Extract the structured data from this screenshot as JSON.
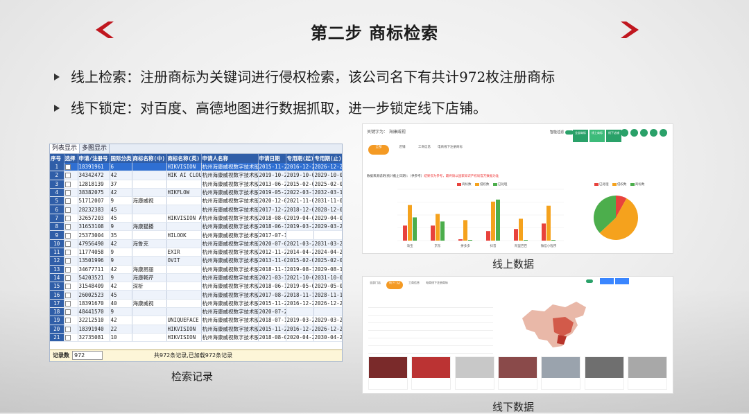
{
  "slide": {
    "title": "第二步 商标检索",
    "bullets": [
      "线上检索：注册商标为关键词进行侵权检索，该公司名下有共计972枚注册商标",
      "线下锁定：对百度、高德地图进行数据抓取，进一步锁定线下店铺。"
    ],
    "captions": {
      "records": "检索记录",
      "online": "线上数据",
      "offline": "线下数据"
    },
    "accent_color": "#c0171f"
  },
  "records": {
    "tabs": [
      "列表显示",
      "多图显示"
    ],
    "columns": [
      "序号",
      "选择",
      "申请/注册号",
      "国际分类",
      "商标名称(中)",
      "商标名称(英)",
      "申请人名称",
      "申请日期",
      "专用期(起)",
      "专用期(止)"
    ],
    "rows": [
      [
        "1",
        "",
        "18391961",
        "6",
        "",
        "HIKVISION",
        "杭州海康威视数字技术股份有",
        "2015-11-23",
        "2016-12-28",
        "2026-12-27"
      ],
      [
        "2",
        "",
        "34342472",
        "42",
        "",
        "HIK AI CLOUD",
        "杭州海康威视数字技术股份有",
        "2019-10-29",
        "2019-10-07",
        "2029-10-06"
      ],
      [
        "3",
        "",
        "12818139",
        "37",
        "",
        "",
        "杭州海康威视数字技术股份有",
        "2013-06-26",
        "2015-02-07",
        "2025-02-06"
      ],
      [
        "4",
        "",
        "38382075",
        "42",
        "",
        "HIKFLOW",
        "杭州海康威视数字技术股份有",
        "2019-05-23",
        "2022-03-14",
        "2032-03-13"
      ],
      [
        "5",
        "",
        "51712007",
        "9",
        "海康威视",
        "",
        "杭州海康威视数字技术股份有",
        "2020-12-01",
        "2021-11-07",
        "2031-11-06"
      ],
      [
        "6",
        "",
        "28232383",
        "45",
        "",
        "",
        "杭州海康威视数字技术股份有",
        "2017-12-21",
        "2018-12-07",
        "2028-12-06"
      ],
      [
        "7",
        "",
        "32657203",
        "45",
        "",
        "HIKVISION AI CL",
        "杭州海康威视数字技术股份有",
        "2018-08-02",
        "2019-04-07",
        "2029-04-06"
      ],
      [
        "8",
        "",
        "31653108",
        "9",
        "海康猫播",
        "",
        "杭州海康威视数字技术股份有",
        "2018-06-15",
        "2019-03-21",
        "2029-03-20"
      ],
      [
        "9",
        "",
        "25373004",
        "35",
        "",
        "HILOOK",
        "杭州海康威视数字技术股份有",
        "2017-07-18",
        "",
        ""
      ],
      [
        "10",
        "",
        "47956490",
        "42",
        "海鲁克",
        "",
        "杭州海康威视数字技术股份有",
        "2020-07-09",
        "2021-03-21",
        "2031-03-20"
      ],
      [
        "11",
        "",
        "11774058",
        "9",
        "",
        "EXIR",
        "杭州海康威视数字技术股份有",
        "2012-11-20",
        "2014-04-28",
        "2024-04-27"
      ],
      [
        "12",
        "",
        "13501996",
        "9",
        "",
        "OVIT",
        "杭州海康威视数字技术股份有",
        "2013-11-07",
        "2015-02-07",
        "2025-02-06"
      ],
      [
        "13",
        "",
        "34677711",
        "42",
        "海康昂丽",
        "",
        "杭州海康威视数字技术股份有",
        "2018-11-14",
        "2019-08-14",
        "2029-08-13"
      ],
      [
        "14",
        "",
        "54203521",
        "9",
        "海康畅芹",
        "",
        "杭州海康威视数字技术股份有",
        "2021-03-10",
        "2021-10-07",
        "2031-10-06"
      ],
      [
        "15",
        "",
        "31548409",
        "42",
        "深析",
        "",
        "杭州海康威视数字技术股份有",
        "2018-06-12",
        "2019-05-07",
        "2029-05-06"
      ],
      [
        "16",
        "",
        "26002523",
        "45",
        "",
        "",
        "杭州海康威视数字技术股份有",
        "2017-08-22",
        "2018-11-14",
        "2028-11-13"
      ],
      [
        "17",
        "",
        "18391670",
        "40",
        "海康威视",
        "",
        "杭州海康威视数字技术股份有",
        "2015-11-23",
        "2016-12-28",
        "2026-12-27"
      ],
      [
        "18",
        "",
        "48441570",
        "9",
        "",
        "",
        "杭州海康威视数字技术股份有",
        "2020-07-28",
        "",
        ""
      ],
      [
        "19",
        "",
        "32212510",
        "42",
        "",
        "UNIQUEFACE",
        "杭州海康威视数字技术股份有",
        "2018-07-12",
        "2019-03-28",
        "2029-03-27"
      ],
      [
        "20",
        "",
        "18391940",
        "22",
        "",
        "HIKVISION",
        "杭州海康威视数字技术股份有",
        "2015-11-23",
        "2016-12-28",
        "2026-12-27"
      ],
      [
        "21",
        "",
        "32735081",
        "10",
        "",
        "HIKVISION",
        "杭州海康威视数字技术股份有",
        "2018-08-07",
        "2020-04-28",
        "2030-04-27"
      ]
    ],
    "selected_row": 1,
    "footer_label": "记录数",
    "footer_value": "972",
    "footer_summary": "共972条记录,已加载972条记录"
  },
  "dashboard": {
    "keyword_line": "关键字为：  海康威视",
    "tabs": [
      "全部",
      "店铺",
      "工商信息",
      "电商线下注册商标"
    ],
    "toggle_label": "智能过滤",
    "cards": [
      "全部商标",
      "线上商标",
      "线下店铺"
    ],
    "note_prefix": "数据来源说明(统计截止日期)：（供参考）",
    "note_red": "结果仅为参考，最终请以国家知识产权局官方数据为准",
    "bar_legend": [
      "商标数",
      "侵权数",
      "已处理"
    ],
    "pie_legend": [
      "已处理",
      "侵权数",
      "商标数"
    ],
    "colors": [
      "#e8423c",
      "#f5a21d",
      "#4cae4c"
    ]
  },
  "chart_data": [
    {
      "type": "bar",
      "categories": [
        "淘宝",
        "京东",
        "拼多多",
        "抖音",
        "阿里巴巴",
        "微信小程序"
      ],
      "series": [
        {
          "name": "商标数",
          "values": [
            22,
            22,
            2,
            14,
            17,
            25
          ]
        },
        {
          "name": "侵权数",
          "values": [
            52,
            39,
            30,
            57,
            32,
            51
          ]
        },
        {
          "name": "已处理",
          "values": [
            34,
            28,
            1,
            60,
            1,
            1
          ]
        }
      ],
      "ylim": [
        0,
        75
      ]
    },
    {
      "type": "pie",
      "series": [
        {
          "name": "商标数",
          "value": 8
        },
        {
          "name": "侵权数",
          "value": 55
        },
        {
          "name": "已处理",
          "value": 37
        }
      ]
    }
  ],
  "offline": {
    "tabs": [
      "全部门店",
      "线下门店",
      "工商信息",
      "电商线下注册商标"
    ],
    "stores_count": 7
  }
}
